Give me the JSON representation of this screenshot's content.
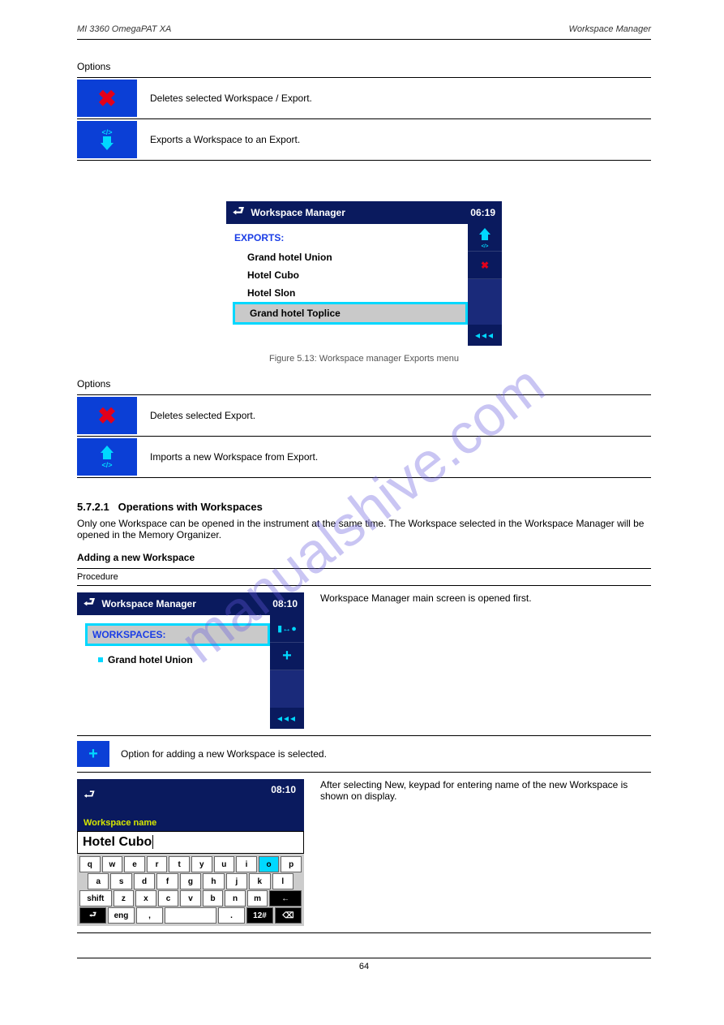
{
  "header": {
    "left": "MI 3360 OmegaPAT XA",
    "right": "Workspace Manager"
  },
  "options_label": "Options",
  "opt_delete": "Deletes selected Workspace / Export.",
  "opt_export": "Exports a Workspace to an Export.",
  "figure1": {
    "title": "Workspace Manager",
    "time": "06:19",
    "label": "EXPORTS:",
    "items": [
      "Grand hotel Union",
      "Hotel Cubo",
      "Hotel Slon",
      "Grand hotel Toplice"
    ],
    "caption": "Figure 5.13: Workspace manager Exports menu"
  },
  "options_label2": "Options",
  "opt_delete2": "Deletes selected Export.",
  "opt_import": "Imports a new Workspace from Export.",
  "section_num": "5.7.2.1",
  "section_title": "Operations with Workspaces",
  "intro": "Only one Workspace can be opened in the instrument at the same time. The Workspace selected in the Workspace Manager will be opened in the Memory Organizer.",
  "sub_head": "Adding a new Workspace",
  "proc_label": "Procedure",
  "figure2": {
    "title": "Workspace Manager",
    "time": "08:10",
    "label": "WORKSPACES:",
    "item": "Grand hotel Union",
    "right_text": "Workspace Manager main screen is opened first."
  },
  "add_option": {
    "text": "Option for adding a new Workspace is selected."
  },
  "keyboard": {
    "time": "08:10",
    "label": "Workspace name",
    "value": "Hotel Cubo",
    "row1": [
      "q",
      "w",
      "e",
      "r",
      "t",
      "y",
      "u",
      "i",
      "o",
      "p"
    ],
    "row2": [
      "a",
      "s",
      "d",
      "f",
      "g",
      "h",
      "j",
      "k",
      "l"
    ],
    "row3_shift": "shift",
    "row3": [
      "z",
      "x",
      "c",
      "v",
      "b",
      "n",
      "m"
    ],
    "row4_left": "⮐",
    "row4_eng": "eng",
    "row4_comma": ",",
    "row4_period": ".",
    "row4_12": "12#",
    "row4_back": "⌫",
    "right_text": "After selecting New, keypad for entering name of the new Workspace is shown on display."
  },
  "footer": "64",
  "watermark": "manualshive.com"
}
